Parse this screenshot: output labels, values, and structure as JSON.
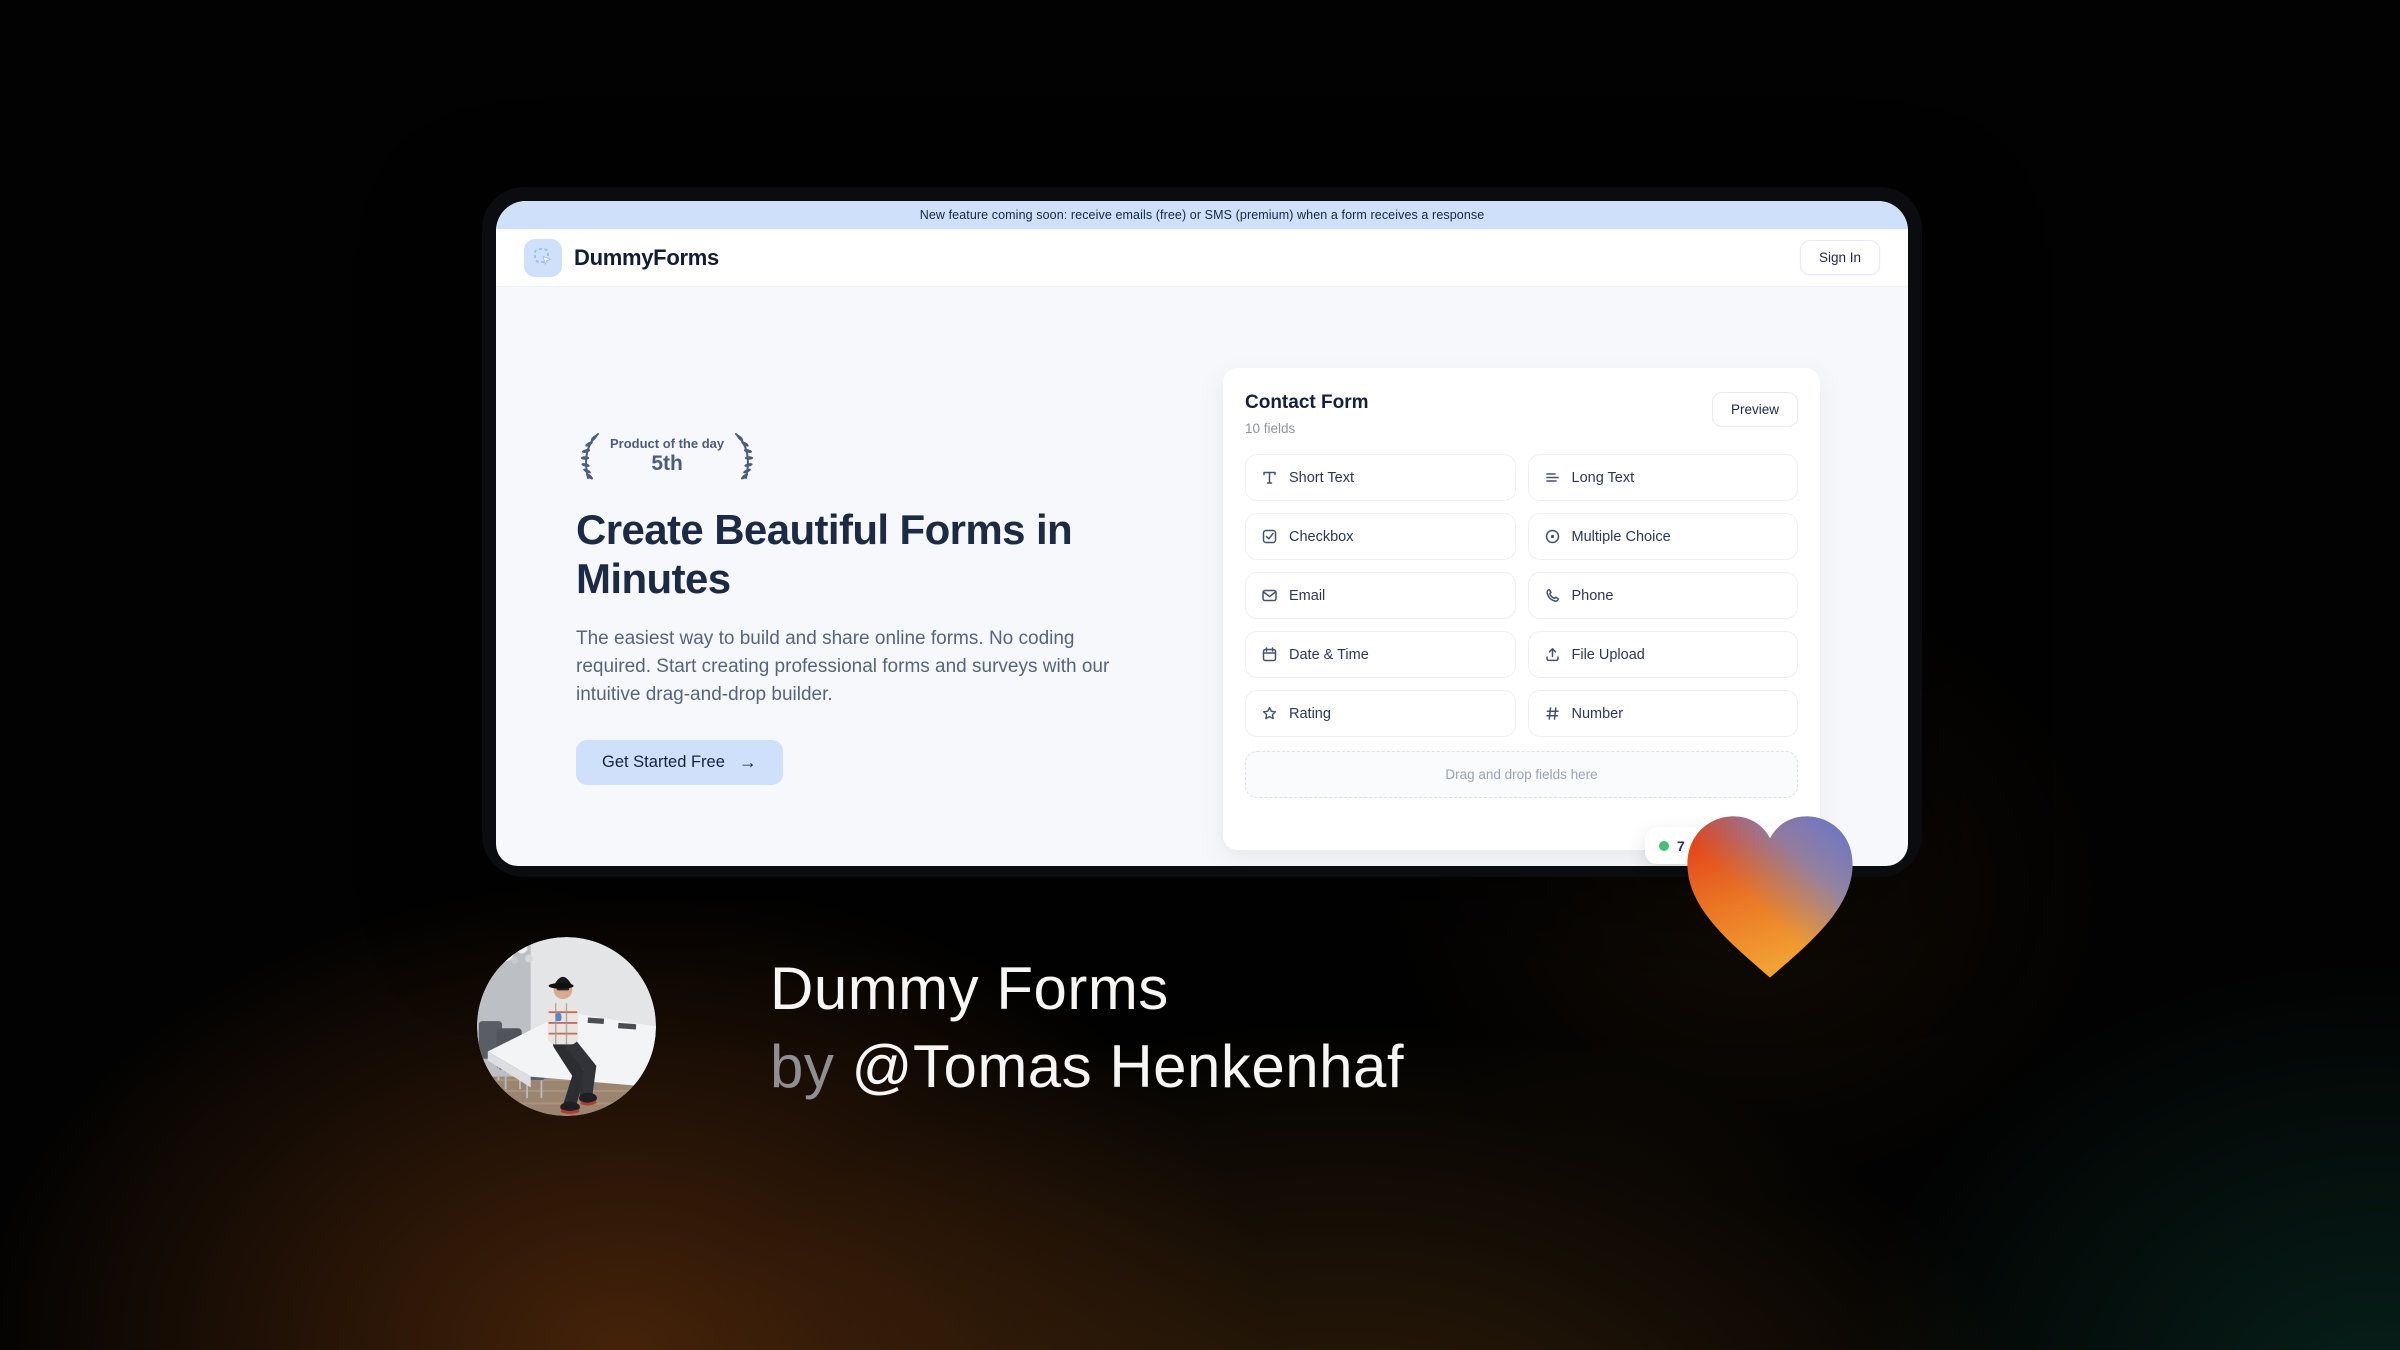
{
  "banner": {
    "text": "New feature coming soon: receive emails (free) or SMS (premium) when a form receives a response"
  },
  "header": {
    "brand": "DummyForms",
    "sign_in_label": "Sign In"
  },
  "hero": {
    "award": {
      "line1": "Product of the day",
      "line2": "5th"
    },
    "headline": "Create Beautiful Forms in Minutes",
    "description": "The easiest way to build and share online forms. No coding required. Start creating professional forms and surveys with our intuitive drag-and-drop builder.",
    "cta_label": "Get Started Free",
    "cta_arrow": "→"
  },
  "form_card": {
    "title": "Contact Form",
    "subtitle": "10 fields",
    "preview_label": "Preview",
    "fields": [
      {
        "label": "Short Text",
        "icon": "short-text-icon"
      },
      {
        "label": "Long Text",
        "icon": "long-text-icon"
      },
      {
        "label": "Checkbox",
        "icon": "checkbox-icon"
      },
      {
        "label": "Multiple Choice",
        "icon": "multiple-choice-icon"
      },
      {
        "label": "Email",
        "icon": "email-icon"
      },
      {
        "label": "Phone",
        "icon": "phone-icon"
      },
      {
        "label": "Date & Time",
        "icon": "calendar-icon"
      },
      {
        "label": "File Upload",
        "icon": "upload-icon"
      },
      {
        "label": "Rating",
        "icon": "star-icon"
      },
      {
        "label": "Number",
        "icon": "hash-icon"
      }
    ],
    "dropzone_text": "Drag and drop fields here"
  },
  "toast": {
    "visible_text": "7"
  },
  "credit": {
    "title": "Dummy Forms",
    "byline_prefix": "by",
    "byline_handle": "@Tomas Henkenhaf"
  },
  "colors": {
    "accent_light_blue": "#cfe0fb",
    "navy_text": "#1c2a44",
    "award_slate": "#4c5c80",
    "toast_green": "#43c072",
    "heart_red": "#e03318",
    "heart_orange": "#f2a233",
    "heart_purple": "#6d77c6"
  }
}
